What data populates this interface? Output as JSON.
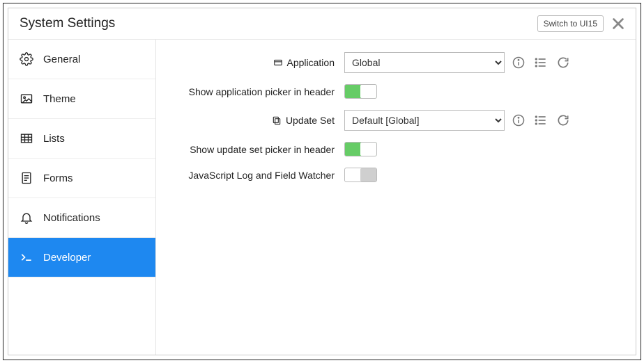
{
  "header": {
    "title": "System Settings",
    "switch_label": "Switch to UI15"
  },
  "sidebar": {
    "items": [
      {
        "label": "General"
      },
      {
        "label": "Theme"
      },
      {
        "label": "Lists"
      },
      {
        "label": "Forms"
      },
      {
        "label": "Notifications"
      },
      {
        "label": "Developer"
      }
    ],
    "active_index": 5
  },
  "form": {
    "application": {
      "label": "Application",
      "value": "Global"
    },
    "app_picker": {
      "label": "Show application picker in header",
      "on": true
    },
    "update_set": {
      "label": "Update Set",
      "value": "Default [Global]"
    },
    "us_picker": {
      "label": "Show update set picker in header",
      "on": true
    },
    "js_log": {
      "label": "JavaScript Log and Field Watcher",
      "on": false
    }
  }
}
